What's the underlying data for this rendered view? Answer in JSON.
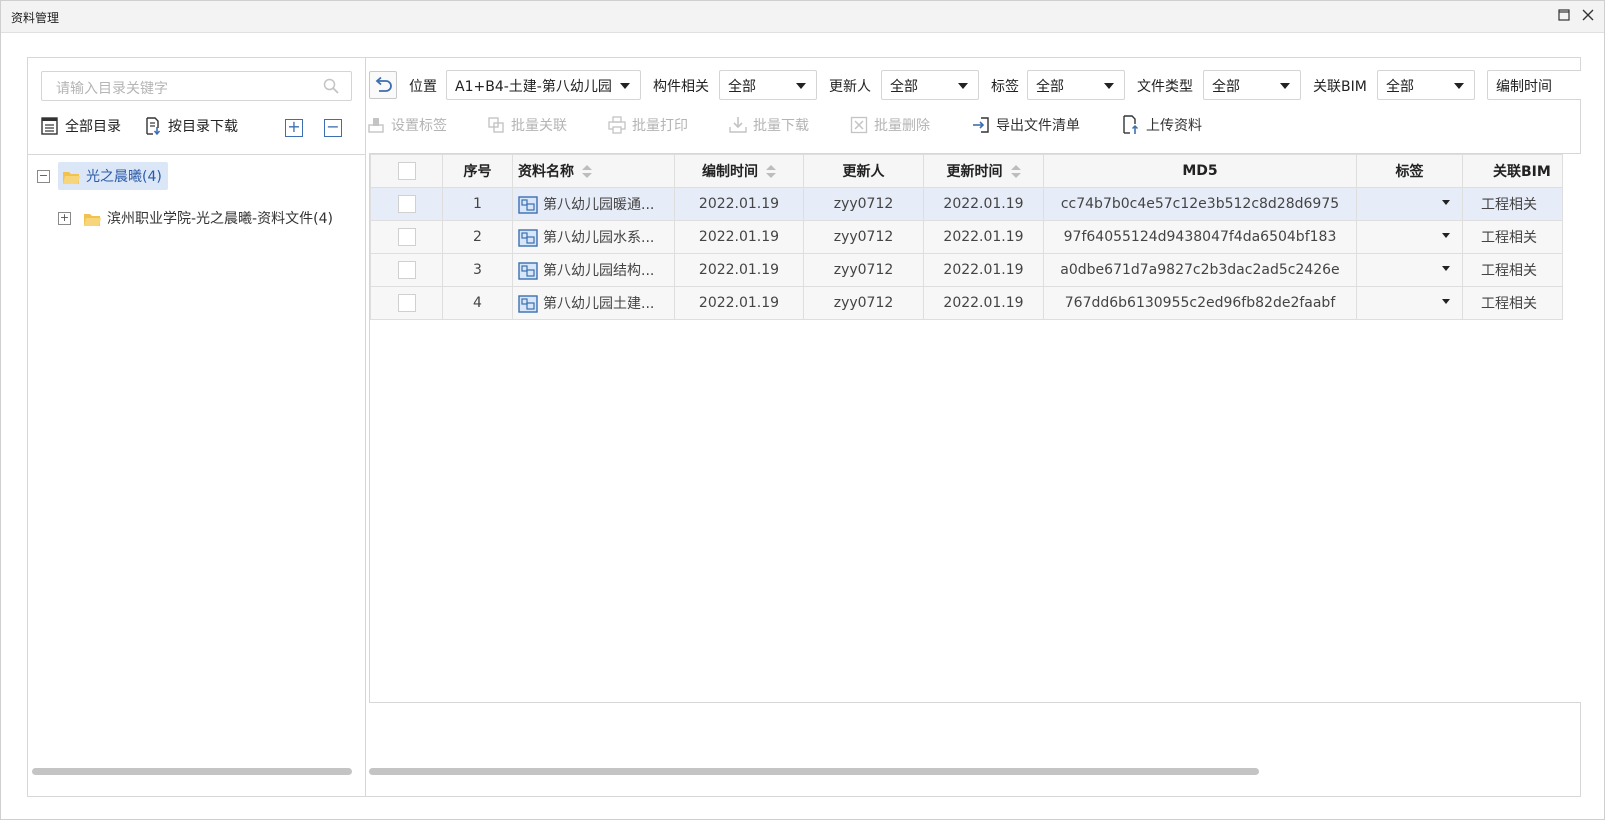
{
  "window": {
    "title": "资料管理"
  },
  "left": {
    "search_placeholder": "请输入目录关键字",
    "all_catalog": "全部目录",
    "download_by_catalog": "按目录下载",
    "tree": [
      {
        "label": "光之晨曦(4)",
        "expanded": true,
        "selected": true
      },
      {
        "label": "滨州职业学院-光之晨曦-资料文件(4)",
        "expanded": false,
        "selected": false
      }
    ]
  },
  "filters": {
    "location_label": "位置",
    "location_value": "A1+B4-土建-第八幼儿园",
    "component_label": "构件相关",
    "component_value": "全部",
    "updater_label": "更新人",
    "updater_value": "全部",
    "tag_label": "标签",
    "tag_value": "全部",
    "filetype_label": "文件类型",
    "filetype_value": "全部",
    "bim_label": "关联BIM",
    "bim_value": "全部",
    "edit_time_label": "编制时间"
  },
  "actions": {
    "set_tag": "设置标签",
    "batch_link": "批量关联",
    "batch_print": "批量打印",
    "batch_download": "批量下载",
    "batch_delete": "批量删除",
    "export_list": "导出文件清单",
    "upload": "上传资料"
  },
  "table": {
    "headers": {
      "index": "序号",
      "name": "资料名称",
      "edit_time": "编制时间",
      "updater": "更新人",
      "update_time": "更新时间",
      "md5": "MD5",
      "tag": "标签",
      "bim": "关联BIM"
    },
    "rows": [
      {
        "index": "1",
        "name": "第八幼儿园暖通...",
        "edit_time": "2022.01.19",
        "updater": "zyy0712",
        "update_time": "2022.01.19",
        "md5": "cc74b7b0c4e57c12e3b512c8d28d6975",
        "tag": "",
        "bim": "工程相关"
      },
      {
        "index": "2",
        "name": "第八幼儿园水系...",
        "edit_time": "2022.01.19",
        "updater": "zyy0712",
        "update_time": "2022.01.19",
        "md5": "97f64055124d9438047f4da6504bf183",
        "tag": "",
        "bim": "工程相关"
      },
      {
        "index": "3",
        "name": "第八幼儿园结构...",
        "edit_time": "2022.01.19",
        "updater": "zyy0712",
        "update_time": "2022.01.19",
        "md5": "a0dbe671d7a9827c2b3dac2ad5c2426e",
        "tag": "",
        "bim": "工程相关"
      },
      {
        "index": "4",
        "name": "第八幼儿园土建...",
        "edit_time": "2022.01.19",
        "updater": "zyy0712",
        "update_time": "2022.01.19",
        "md5": "767dd6b6130955c2ed96fb82de2faabf",
        "tag": "",
        "bim": "工程相关"
      }
    ]
  },
  "colors": {
    "accent": "#3d6fb0",
    "selected_row": "#e7edf8",
    "folder": "#f2c14e"
  }
}
